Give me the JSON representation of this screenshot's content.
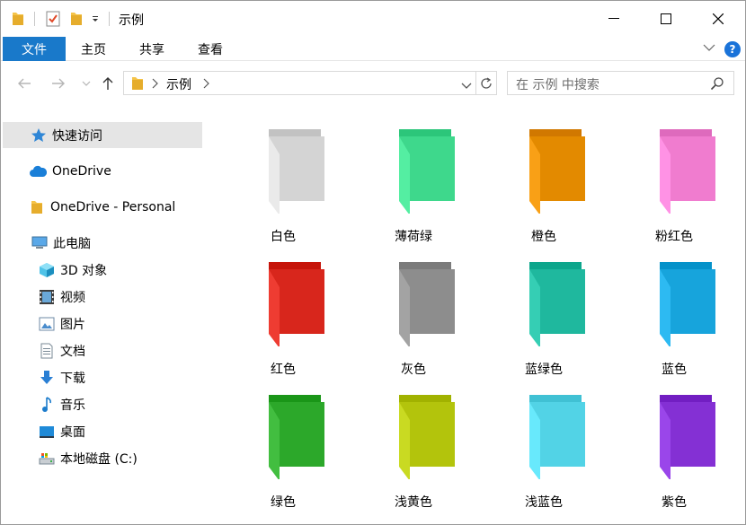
{
  "window": {
    "title": "示例",
    "minimize_label": "minimize",
    "maximize_label": "maximize",
    "close_label": "close"
  },
  "ribbon": {
    "tabs": [
      {
        "label": "文件"
      },
      {
        "label": "主页"
      },
      {
        "label": "共享"
      },
      {
        "label": "查看"
      }
    ],
    "help": "?"
  },
  "address": {
    "path": "示例",
    "search_placeholder": "在 示例 中搜索"
  },
  "nav": {
    "quick_access": "快速访问",
    "onedrive": "OneDrive",
    "onedrive_personal": "OneDrive - Personal",
    "this_pc": "此电脑",
    "items": [
      {
        "label": "3D 对象",
        "icon": "cube-3d-icon"
      },
      {
        "label": "视频",
        "icon": "video-icon"
      },
      {
        "label": "图片",
        "icon": "pictures-icon"
      },
      {
        "label": "文档",
        "icon": "document-icon"
      },
      {
        "label": "下载",
        "icon": "download-icon"
      },
      {
        "label": "音乐",
        "icon": "music-icon"
      },
      {
        "label": "桌面",
        "icon": "desktop-icon"
      },
      {
        "label": "本地磁盘 (C:)",
        "icon": "drive-icon"
      }
    ]
  },
  "folders": [
    {
      "label": "白色",
      "color": "#d4d4d4"
    },
    {
      "label": "薄荷绿",
      "color": "#3ed88c"
    },
    {
      "label": "橙色",
      "color": "#e38a00"
    },
    {
      "label": "粉红色",
      "color": "#f07ccf"
    },
    {
      "label": "红色",
      "color": "#d8261c"
    },
    {
      "label": "灰色",
      "color": "#8d8d8d"
    },
    {
      "label": "蓝绿色",
      "color": "#1fb89e"
    },
    {
      "label": "蓝色",
      "color": "#17a4dc"
    },
    {
      "label": "绿色",
      "color": "#2ca82a"
    },
    {
      "label": "浅黄色",
      "color": "#b3c40c"
    },
    {
      "label": "浅蓝色",
      "color": "#52d3e6"
    },
    {
      "label": "紫色",
      "color": "#8430d4"
    }
  ],
  "colors": {
    "accent": "#1979ca",
    "selected_nav": "#e5e5e5"
  }
}
